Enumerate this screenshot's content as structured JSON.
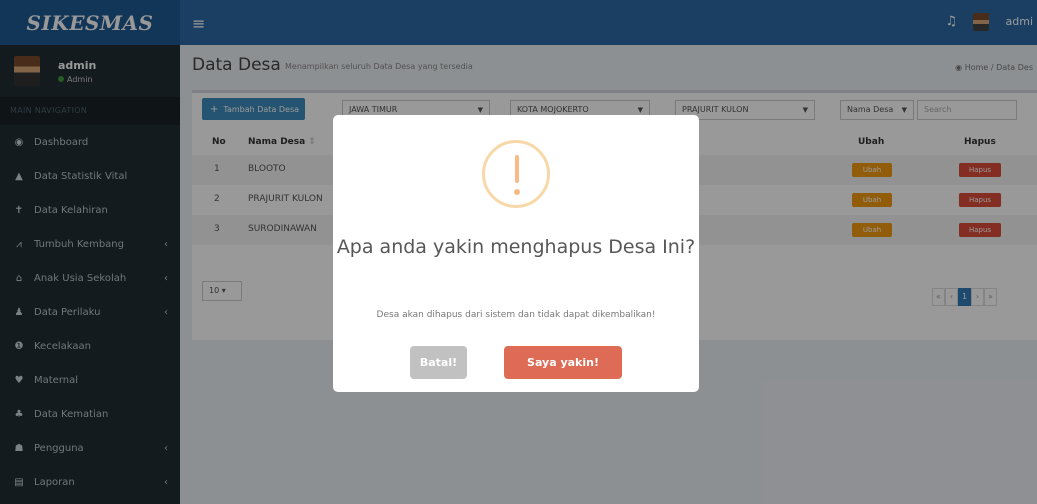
{
  "app": {
    "brand": "SIKESMAS"
  },
  "topbar": {
    "user": "admi"
  },
  "sidebar": {
    "user_name": "admin",
    "user_status": "Admin",
    "nav_header": "MAIN NAVIGATION",
    "items": [
      {
        "label": "Dashboard",
        "icon": "dashboard-icon",
        "glyph": "◉",
        "has_sub": false
      },
      {
        "label": "Data Statistik Vital",
        "icon": "user-icon",
        "glyph": "▲",
        "has_sub": false
      },
      {
        "label": "Data Kelahiran",
        "icon": "child-icon",
        "glyph": "✝",
        "has_sub": false
      },
      {
        "label": "Tumbuh Kembang",
        "icon": "line-chart-icon",
        "glyph": "⩘",
        "has_sub": true
      },
      {
        "label": "Anak Usia Sekolah",
        "icon": "school-icon",
        "glyph": "⌂",
        "has_sub": true
      },
      {
        "label": "Data Perilaku",
        "icon": "users-icon",
        "glyph": "♟",
        "has_sub": true
      },
      {
        "label": "Kecelakaan",
        "icon": "info-icon",
        "glyph": "❶",
        "has_sub": false
      },
      {
        "label": "Maternal",
        "icon": "heart-icon",
        "glyph": "♥",
        "has_sub": false
      },
      {
        "label": "Data Kematian",
        "icon": "group-icon",
        "glyph": "♣",
        "has_sub": false
      },
      {
        "label": "Pengguna",
        "icon": "user-group-icon",
        "glyph": "☗",
        "has_sub": true
      },
      {
        "label": "Laporan",
        "icon": "report-icon",
        "glyph": "▤",
        "has_sub": true
      }
    ]
  },
  "page": {
    "title": "Data Desa",
    "subtitle": "Menampilkan seluruh Data Desa yang tersedia",
    "breadcrumb": "Home  /  Data Des"
  },
  "toolbar": {
    "add_label": "Tambah Data Desa",
    "province": "JAWA TIMUR",
    "city": "KOTA MOJOKERTO",
    "district": "PRAJURIT KULON",
    "search_field": "Nama Desa",
    "search_placeholder": "Search"
  },
  "table": {
    "headers": {
      "no": "No",
      "name": "Nama Desa",
      "edit": "Ubah",
      "delete": "Hapus"
    },
    "rows": [
      {
        "no": "1",
        "name": "BLOOTO",
        "edit": "Ubah",
        "delete": "Hapus"
      },
      {
        "no": "2",
        "name": "PRAJURIT KULON",
        "edit": "Ubah",
        "delete": "Hapus"
      },
      {
        "no": "3",
        "name": "SURODINAWAN",
        "edit": "Ubah",
        "delete": "Hapus"
      }
    ],
    "page_length": "10",
    "pagination": [
      "«",
      "‹",
      "1",
      "›",
      "»"
    ],
    "current_page": "1"
  },
  "modal": {
    "title": "Apa anda yakin menghapus Desa Ini?",
    "text": "Desa akan dihapus dari sistem dan tidak dapat dikembalikan!",
    "cancel": "Batal!",
    "confirm": "Saya yakin!"
  },
  "colors": {
    "brand": "#1e5a93",
    "topbar": "#2d6aa6",
    "sidebar": "#222d32",
    "primary": "#3c8dbc",
    "warning": "#f39c12",
    "danger": "#dd4b39",
    "confirm": "#dd6b55"
  }
}
